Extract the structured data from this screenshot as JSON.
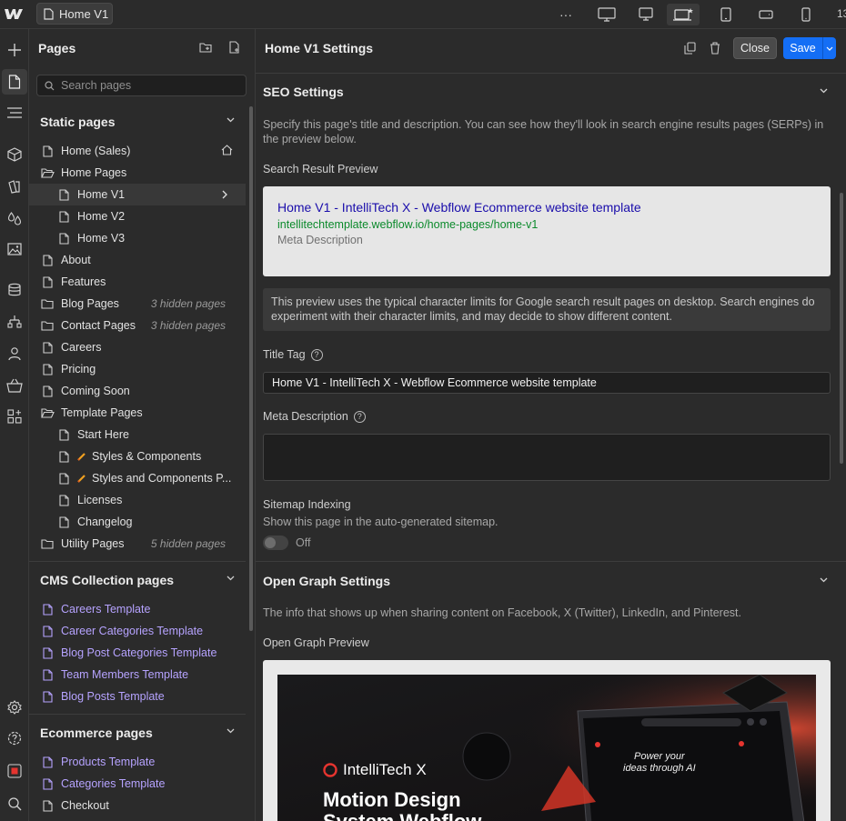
{
  "topbar": {
    "page_tab": "Home V1",
    "more": "···",
    "trailing_number": "13",
    "icons": [
      "webflow-logo-icon",
      "page-icon",
      "more-icon",
      "desktop-large-icon",
      "desktop-icon",
      "desktop-base-star-icon",
      "tablet-icon",
      "mobile-landscape-icon",
      "mobile-portrait-icon"
    ]
  },
  "rail": {
    "icons": [
      "add-icon",
      "pages-icon",
      "navigator-icon",
      "components-icon",
      "styles-icon",
      "variables-icon",
      "assets-icon",
      "cms-icon",
      "logic-icon",
      "users-icon",
      "ecommerce-icon",
      "apps-icon",
      "settings-icon",
      "help-icon",
      "record-icon",
      "search-icon"
    ]
  },
  "pages_panel": {
    "title": "Pages",
    "search_placeholder": "Search pages",
    "static_header": "Static pages",
    "static_items": [
      {
        "label": "Home (Sales)",
        "indent": 0,
        "icon": "page",
        "extra": "home"
      },
      {
        "label": "Home Pages",
        "indent": 0,
        "icon": "folder-open"
      },
      {
        "label": "Home V1",
        "indent": 1,
        "icon": "page",
        "selected": true
      },
      {
        "label": "Home V2",
        "indent": 1,
        "icon": "page"
      },
      {
        "label": "Home V3",
        "indent": 1,
        "icon": "page"
      },
      {
        "label": "About",
        "indent": 0,
        "icon": "page"
      },
      {
        "label": "Features",
        "indent": 0,
        "icon": "page"
      },
      {
        "label": "Blog Pages",
        "indent": 0,
        "icon": "folder",
        "hidden": "3 hidden pages"
      },
      {
        "label": "Contact Pages",
        "indent": 0,
        "icon": "folder",
        "hidden": "3 hidden pages"
      },
      {
        "label": "Careers",
        "indent": 0,
        "icon": "page"
      },
      {
        "label": "Pricing",
        "indent": 0,
        "icon": "page"
      },
      {
        "label": "Coming Soon",
        "indent": 0,
        "icon": "page"
      },
      {
        "label": "Template Pages",
        "indent": 0,
        "icon": "folder-open"
      },
      {
        "label": "Start Here",
        "indent": 1,
        "icon": "page"
      },
      {
        "label": "Styles & Components",
        "indent": 1,
        "icon": "page",
        "pencil": true
      },
      {
        "label": "Styles and Components P...",
        "indent": 1,
        "icon": "page",
        "pencil": true
      },
      {
        "label": "Licenses",
        "indent": 1,
        "icon": "page"
      },
      {
        "label": "Changelog",
        "indent": 1,
        "icon": "page"
      },
      {
        "label": "Utility Pages",
        "indent": 0,
        "icon": "folder",
        "hidden": "5 hidden pages"
      }
    ],
    "cms_header": "CMS Collection pages",
    "cms_items": [
      "Careers Template",
      "Career Categories Template",
      "Blog Post Categories Template",
      "Team Members Template",
      "Blog Posts Template"
    ],
    "ecom_header": "Ecommerce pages",
    "ecom_items": [
      {
        "label": "Products Template",
        "cms": true
      },
      {
        "label": "Categories Template",
        "cms": true
      },
      {
        "label": "Checkout",
        "cms": false
      }
    ]
  },
  "settings": {
    "title": "Home V1 Settings",
    "close_label": "Close",
    "save_label": "Save",
    "seo": {
      "heading": "SEO Settings",
      "description": "Specify this page's title and description. You can see how they'll look in search engine results pages (SERPs) in the preview below.",
      "preview_label": "Search Result Preview",
      "preview_title": "Home V1 - IntelliTech X - Webflow Ecommerce website template",
      "preview_url": "intellitechtemplate.webflow.io/home-pages/home-v1",
      "preview_meta": "Meta Description",
      "note": "This preview uses the typical character limits for Google search result pages on desktop. Search engines do experiment with their character limits, and may decide to show different content.",
      "title_tag_label": "Title Tag",
      "title_tag_value": "Home V1 - IntelliTech X - Webflow Ecommerce website template",
      "meta_label": "Meta Description",
      "sitemap_label": "Sitemap Indexing",
      "sitemap_desc": "Show this page in the auto-generated sitemap.",
      "sitemap_state": "Off",
      "help_mark": "?"
    },
    "og": {
      "heading": "Open Graph Settings",
      "description": "The info that shows up when sharing content on Facebook, X (Twitter), LinkedIn, and Pinterest.",
      "preview_label": "Open Graph Preview",
      "brand": "IntelliTech X",
      "headline_1": "Motion Design",
      "headline_2": "System Webflow",
      "screen_text_1": "Power your",
      "screen_text_2": "ideas through AI"
    }
  },
  "colors": {
    "accent": "#146ef5",
    "cms_link": "#b6a3ff",
    "serp_title": "#1a0dab",
    "serp_url": "#0b8a2b"
  }
}
